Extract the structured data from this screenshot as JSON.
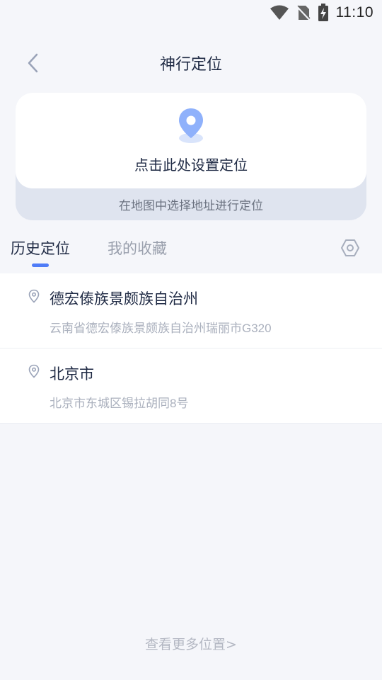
{
  "status_bar": {
    "time": "11:10",
    "icons": [
      "wifi-icon",
      "no-sim-icon",
      "battery-charging-icon"
    ]
  },
  "header": {
    "title": "神行定位",
    "back_icon": "chevron-left-icon"
  },
  "location_card": {
    "icon": "location-pin-icon",
    "action_label": "点击此处设置定位",
    "hint": "在地图中选择地址进行定位"
  },
  "tabs": [
    {
      "label": "历史定位",
      "active": true
    },
    {
      "label": "我的收藏",
      "active": false
    }
  ],
  "settings_icon": "hexagon-settings-icon",
  "history": [
    {
      "title": "德宏傣族景颇族自治州",
      "address": "云南省德宏傣族景颇族自治州瑞丽市G320"
    },
    {
      "title": "北京市",
      "address": "北京市东城区锡拉胡同8号"
    }
  ],
  "more_link": "查看更多位置>",
  "colors": {
    "background": "#f5f6fa",
    "accent": "#4f7cf7",
    "card_hint_bg": "#dfe4ef",
    "pin_blue": "#8fb1fb"
  }
}
